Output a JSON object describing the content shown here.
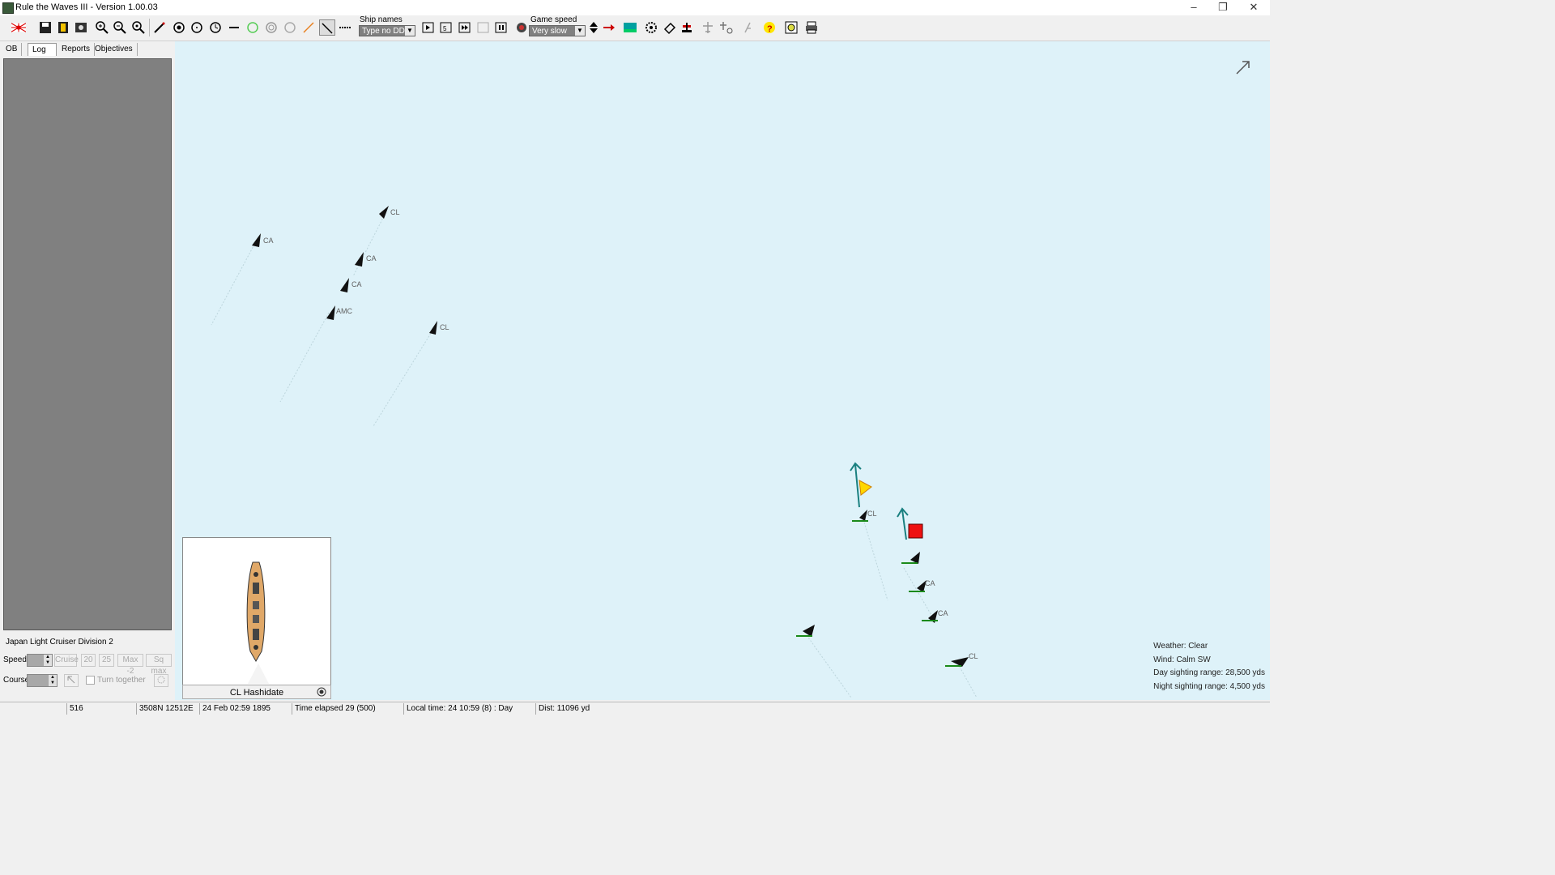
{
  "window": {
    "title": "Rule the Waves III - Version 1.00.03",
    "minimize": "–",
    "restore": "❐",
    "close": "✕"
  },
  "toolbar": {
    "ship_names_label": "Ship names",
    "ship_names_value": "Type no DD",
    "game_speed_label": "Game speed",
    "game_speed_value": "Very slow",
    "icons": [
      "japan-flag-icon",
      "save-icon",
      "note-icon",
      "options-icon",
      "zoom-in-icon",
      "zoom-out-icon",
      "zoom-fit-icon",
      "pencil-icon",
      "target-icon",
      "circle-icon",
      "clock-icon",
      "line-icon",
      "ring-green-icon",
      "ring-gray-icon",
      "ring-light-icon",
      "arrow-orange-icon",
      "arrow-black-icon",
      "dash-icon",
      "play-icon",
      "step-icon",
      "fast-icon",
      "slow-icon",
      "pause-icon",
      "radar-icon",
      "speed-up-icon",
      "red-arrow-icon",
      "map-icon",
      "gear-icon",
      "eraser-icon",
      "anchor-icon",
      "planes-icon",
      "plane-target-icon",
      "torpedo-icon",
      "help-icon",
      "report-icon",
      "print-icon"
    ]
  },
  "tabs": {
    "ob": "OB",
    "log": "Log",
    "reports": "Reports",
    "objectives": "Objectives"
  },
  "division": {
    "name": "Japan Light Cruiser Division 2",
    "speed_label": "Speed",
    "course_label": "Course",
    "cruise": "Cruise",
    "speed_20": "20",
    "speed_25": "25",
    "max_minus_2": "Max -2",
    "sq_max": "Sq max",
    "turn_together": "Turn together"
  },
  "selected_ship": {
    "name": "CL Hashidate"
  },
  "enemy_ships": [
    {
      "label": "CL"
    },
    {
      "label": "CA"
    },
    {
      "label": "CA"
    },
    {
      "label": "CA"
    },
    {
      "label": "AMC"
    },
    {
      "label": "CL"
    }
  ],
  "friendly_ships": [
    {
      "label": "CL"
    },
    {
      "label": ""
    },
    {
      "label": "CA"
    },
    {
      "label": "CA"
    },
    {
      "label": ""
    },
    {
      "label": "CL"
    }
  ],
  "weather": {
    "line1": "Weather: Clear",
    "line2": "Wind: Calm  SW",
    "line3": "Day sighting range: 28,500 yds",
    "line4": "Night sighting range: 4,500 yds"
  },
  "status": {
    "id": "516",
    "position": "3508N 12512E",
    "date": "24 Feb 02:59 1895",
    "elapsed": "Time elapsed 29 (500)",
    "local_time": "Local time: 24 10:59 (8) : Day",
    "dist": "Dist: 11096 yd"
  },
  "colors": {
    "map_bg": "#def2f9",
    "track_arrow": "#1a8080",
    "flag_red": "#ee1111",
    "flag_yellow": "#ffd700",
    "friendly_line": "#1a8a1a"
  }
}
